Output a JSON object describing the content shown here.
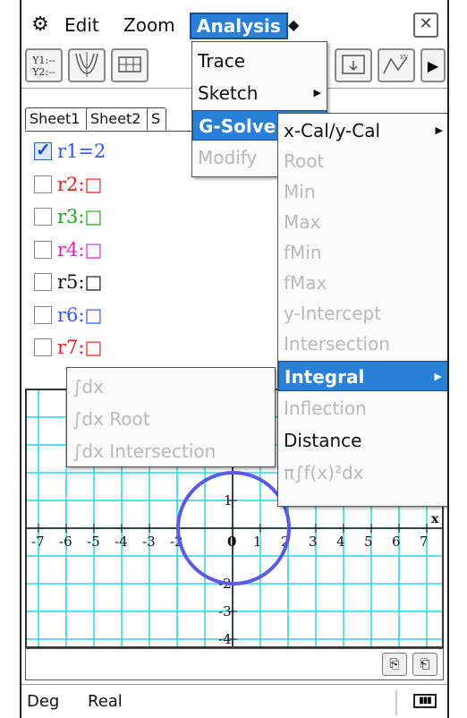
{
  "menubar": {
    "gear": "⚙",
    "edit": "Edit",
    "zoom": "Zoom",
    "analysis": "Analysis",
    "diamond": "◆",
    "close": "✕"
  },
  "toolbar": {
    "b1_line1": "Y1:--",
    "b1_line2": "Y2:--",
    "more": "▶"
  },
  "sheets": [
    "Sheet1",
    "Sheet2",
    "S"
  ],
  "functions": [
    {
      "label": "r1=2",
      "checked": true,
      "color": "#3355ee"
    },
    {
      "label": "r2:□",
      "checked": false,
      "color": "#e02020"
    },
    {
      "label": "r3:□",
      "checked": false,
      "color": "#20a020"
    },
    {
      "label": "r4:□",
      "checked": false,
      "color": "#e020c0"
    },
    {
      "label": "r5:□",
      "checked": false,
      "color": "#111111"
    },
    {
      "label": "r6:□",
      "checked": false,
      "color": "#3355ee"
    },
    {
      "label": "r7:□",
      "checked": false,
      "color": "#e02020"
    }
  ],
  "analysis_menu": {
    "trace": "Trace",
    "sketch": "Sketch",
    "gsolve": "G-Solve",
    "modify": "Modify",
    "arrow": "▶"
  },
  "gsolve_menu": {
    "xcal": "x-Cal/y-Cal",
    "root": "Root",
    "min": "Min",
    "max": "Max",
    "fmin": "fMin",
    "fmax": "fMax",
    "yint": "y-Intercept",
    "intersection": "Intersection",
    "integral": "Integral",
    "inflection": "Inflection",
    "distance": "Distance",
    "volume": "π∫f(x)²dx",
    "arrow": "▶"
  },
  "integral_menu": {
    "dx": "∫dx",
    "dx_root": "∫dx Root",
    "dx_intersection": "∫dx Intersection"
  },
  "graph": {
    "x_ticks": [
      "-7",
      "-6",
      "-5",
      "-4",
      "-3",
      "-2",
      "0",
      "1",
      "2",
      "3",
      "4",
      "5",
      "6",
      "7"
    ],
    "y_ticks": [
      "1",
      "-2",
      "-3",
      "-4"
    ],
    "x_axis_label": "x",
    "grid_color": "#28d4e8",
    "circle_color": "#5a5ae6"
  },
  "status": {
    "angle": "Deg",
    "mode": "Real"
  }
}
